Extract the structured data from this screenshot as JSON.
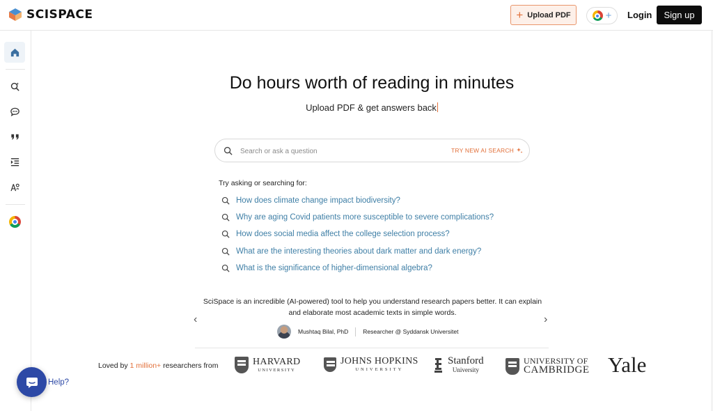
{
  "header": {
    "brand": "SCISPACE",
    "upload_label": "Upload PDF",
    "login_label": "Login",
    "signup_label": "Sign up",
    "extension_icon": "chrome-icon"
  },
  "sidebar": {
    "items": [
      {
        "icon": "home-icon"
      },
      {
        "icon": "search-sparkle-icon"
      },
      {
        "icon": "chat-icon"
      },
      {
        "icon": "quote-icon"
      },
      {
        "icon": "list-indent-icon"
      },
      {
        "icon": "translate-icon"
      },
      {
        "icon": "chrome-icon"
      }
    ]
  },
  "hero": {
    "title": "Do hours worth of reading in minutes",
    "subtitle": "Upload PDF & get answers back"
  },
  "search": {
    "placeholder": "Search or ask a question",
    "ai_label": "TRY NEW AI SEARCH"
  },
  "suggestions": {
    "label": "Try asking or searching for:",
    "items": [
      "How does climate change impact biodiversity?",
      "Why are aging Covid patients more susceptible to severe complications?",
      "How does social media affect the college selection process?",
      "What are the interesting theories about dark matter and dark energy?",
      "What is the significance of higher-dimensional algebra?"
    ]
  },
  "testimonial": {
    "quote": "SciSpace is an incredible (AI-powered) tool to help you understand research papers better. It can explain and elaborate most academic texts in simple words.",
    "author": "Mushtaq Bilal, PhD",
    "role": "Researcher @ Syddansk Universitet"
  },
  "loved": {
    "prefix": "Loved by ",
    "highlight": "1 million+",
    "suffix": " researchers from"
  },
  "universities": {
    "harvard": {
      "name": "HARVARD",
      "sub": "UNIVERSITY"
    },
    "jhu": {
      "name": "JOHNS HOPKINS",
      "sub": "UNIVERSITY"
    },
    "stanford": {
      "name": "Stanford",
      "sub": "University"
    },
    "cambridge": {
      "line1": "UNIVERSITY OF",
      "line2": "CAMBRIDGE"
    },
    "yale": {
      "name": "Yale"
    }
  },
  "help": {
    "label": "Help?"
  },
  "colors": {
    "accent": "#e2703a",
    "link": "#3f7fa6",
    "help": "#2d49a6"
  }
}
